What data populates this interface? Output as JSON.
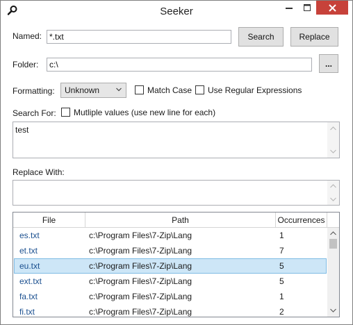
{
  "window": {
    "title": "Seeker"
  },
  "icons": {
    "app": "search-icon",
    "minimize": "minimize-icon",
    "maximize": "maximize-icon",
    "close": "close-icon"
  },
  "colors": {
    "close_button": "#c7423a",
    "selected_row": "#cde6f7",
    "file_link": "#1a4f8f"
  },
  "named": {
    "label": "Named:",
    "value": "*.txt"
  },
  "buttons": {
    "search": "Search",
    "replace": "Replace",
    "browse": "..."
  },
  "folder": {
    "label": "Folder:",
    "value": "c:\\"
  },
  "formatting": {
    "label": "Formatting:",
    "selected": "Unknown"
  },
  "options": {
    "match_case": {
      "label": "Match Case",
      "checked": false
    },
    "regex": {
      "label": "Use Regular Expressions",
      "checked": false
    },
    "multiple": {
      "label": "Mutliple values (use new line for each)",
      "checked": false
    }
  },
  "search_for": {
    "label": "Search For:",
    "value": "test"
  },
  "replace_with": {
    "label": "Replace With:",
    "value": ""
  },
  "results": {
    "columns": [
      "File",
      "Path",
      "Occurrences"
    ],
    "rows": [
      {
        "file": "es.txt",
        "path": "c:\\Program Files\\7-Zip\\Lang",
        "occurrences": "1",
        "selected": false
      },
      {
        "file": "et.txt",
        "path": "c:\\Program Files\\7-Zip\\Lang",
        "occurrences": "7",
        "selected": false
      },
      {
        "file": "eu.txt",
        "path": "c:\\Program Files\\7-Zip\\Lang",
        "occurrences": "5",
        "selected": true
      },
      {
        "file": "ext.txt",
        "path": "c:\\Program Files\\7-Zip\\Lang",
        "occurrences": "5",
        "selected": false
      },
      {
        "file": "fa.txt",
        "path": "c:\\Program Files\\7-Zip\\Lang",
        "occurrences": "1",
        "selected": false
      },
      {
        "file": "fi.txt",
        "path": "c:\\Program Files\\7-Zip\\Lang",
        "occurrences": "2",
        "selected": false
      }
    ]
  }
}
